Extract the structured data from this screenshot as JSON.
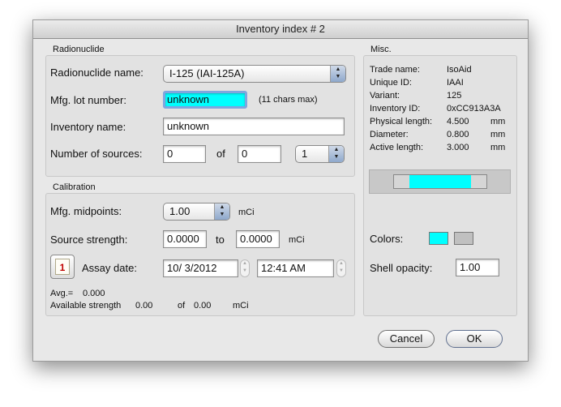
{
  "window": {
    "title": "Inventory index # 2"
  },
  "radionuclide": {
    "group_title": "Radionuclide",
    "name_label": "Radionuclide name:",
    "name_value": "I-125 (IAI-125A)",
    "lot_label": "Mfg. lot number:",
    "lot_value": "unknown",
    "lot_hint": "(11 chars max)",
    "inventory_name_label": "Inventory name:",
    "inventory_name_value": "unknown",
    "num_sources_label": "Number of sources:",
    "num_sources_value": "0",
    "of_label": "of",
    "of_value": "0",
    "count_popup_value": "1"
  },
  "calibration": {
    "group_title": "Calibration",
    "midpoints_label": "Mfg. midpoints:",
    "midpoints_value": "1.00",
    "midpoints_unit": "mCi",
    "strength_label": "Source strength:",
    "strength_from": "0.0000",
    "to_label": "to",
    "strength_to": "0.0000",
    "strength_unit": "mCi",
    "calendar_day": "1",
    "assay_label": "Assay date:",
    "assay_date": "10/ 3/2012",
    "assay_time": "12:41 AM",
    "avg_label": "Avg.=",
    "avg_value": "0.000",
    "available_label": "Available strength",
    "available_value": "0.00",
    "available_of": "of",
    "available_total": "0.00",
    "available_unit": "mCi"
  },
  "misc": {
    "group_title": "Misc.",
    "rows": [
      {
        "label": "Trade name:",
        "value": "IsoAid",
        "unit": ""
      },
      {
        "label": "Unique ID:",
        "value": "IAAI",
        "unit": ""
      },
      {
        "label": "Variant:",
        "value": "125",
        "unit": ""
      },
      {
        "label": "Inventory ID:",
        "value": "0xCC913A3A",
        "unit": ""
      },
      {
        "label": "Physical length:",
        "value": "4.500",
        "unit": "mm"
      },
      {
        "label": "Diameter:",
        "value": "0.800",
        "unit": "mm"
      },
      {
        "label": "Active length:",
        "value": "3.000",
        "unit": "mm"
      }
    ],
    "colors_label": "Colors:",
    "color_primary": "#00ffff",
    "color_secondary": "#c0c0c0",
    "opacity_label": "Shell opacity:",
    "opacity_value": "1.00"
  },
  "buttons": {
    "cancel": "Cancel",
    "ok": "OK"
  }
}
